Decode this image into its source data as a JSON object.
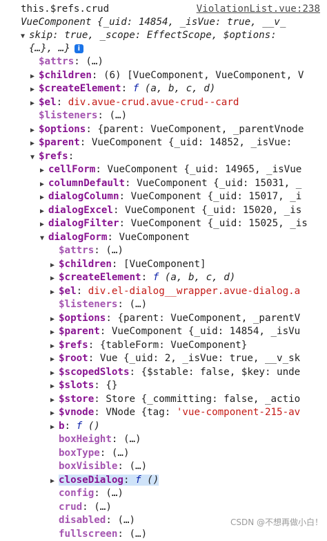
{
  "header": {
    "expression": "this.$refs.crud",
    "source": "ViolationList.vue:238"
  },
  "summary": {
    "line1_type": "VueComponent",
    "line1_rest": "{_uid: 14854, _isVue: true, __v_",
    "line2": "skip: true, _scope: EffectScope, $options:",
    "line3": "{…}, …}"
  },
  "rows": [
    {
      "key": "$attrs",
      "rest": "(…)"
    },
    {
      "key": "$children",
      "rest": "(6) [VueComponent, VueComponent, V"
    },
    {
      "key": "$createElement",
      "fn": "f",
      "rest": "(a, b, c, d)"
    },
    {
      "key": "$el",
      "str": "div.avue-crud.avue-crud--card"
    },
    {
      "key": "$listeners",
      "rest": "(…)"
    },
    {
      "key": "$options",
      "rest": "{parent: VueComponent, _parentVnode"
    },
    {
      "key": "$parent",
      "rest": "VueComponent {_uid: 14852, _isVue: "
    },
    {
      "key": "$refs",
      "rest": ""
    },
    {
      "key": "cellForm",
      "rest": "VueComponent {_uid: 14965, _isVue"
    },
    {
      "key": "columnDefault",
      "rest": "VueComponent {_uid: 15031, _"
    },
    {
      "key": "dialogColumn",
      "rest": "VueComponent {_uid: 15017, _i"
    },
    {
      "key": "dialogExcel",
      "rest": "VueComponent {_uid: 15020, _is"
    },
    {
      "key": "dialogFilter",
      "rest": "VueComponent {_uid: 15025, _is"
    },
    {
      "key": "dialogForm",
      "rest": "VueComponent"
    },
    {
      "key": "$attrs",
      "rest": "(…)"
    },
    {
      "key": "$children",
      "rest": "[VueComponent]"
    },
    {
      "key": "$createElement",
      "fn": "f",
      "rest": "(a, b, c, d)"
    },
    {
      "key": "$el",
      "str": "div.el-dialog__wrapper.avue-dialog.a"
    },
    {
      "key": "$listeners",
      "rest": "(…)"
    },
    {
      "key": "$options",
      "rest": "{parent: VueComponent, _parentV"
    },
    {
      "key": "$parent",
      "rest": "VueComponent {_uid: 14854, _isVu"
    },
    {
      "key": "$refs",
      "rest": "{tableForm: VueComponent}"
    },
    {
      "key": "$root",
      "rest": "Vue {_uid: 2, _isVue: true, __v_sk"
    },
    {
      "key": "$scopedSlots",
      "rest": "{$stable: false, $key: unde"
    },
    {
      "key": "$slots",
      "rest": "{}"
    },
    {
      "key": "$store",
      "rest": "Store {_committing: false, _actio"
    },
    {
      "key": "$vnode",
      "rest": "VNode {tag: 'vue-component-215-av"
    },
    {
      "key": "b",
      "fn": "f",
      "rest": "()"
    },
    {
      "key": "boxHeight",
      "rest": "(…)"
    },
    {
      "key": "boxType",
      "rest": "(…)"
    },
    {
      "key": "boxVisible",
      "rest": "(…)"
    },
    {
      "key": "closeDialog",
      "fn": "f",
      "rest": "()"
    },
    {
      "key": "config",
      "rest": "(…)"
    },
    {
      "key": "crud",
      "rest": "(…)"
    },
    {
      "key": "disabled",
      "rest": "(…)"
    },
    {
      "key": "fullscreen",
      "rest": "(…)"
    }
  ],
  "watermark": "CSDN @不想再做小白！"
}
